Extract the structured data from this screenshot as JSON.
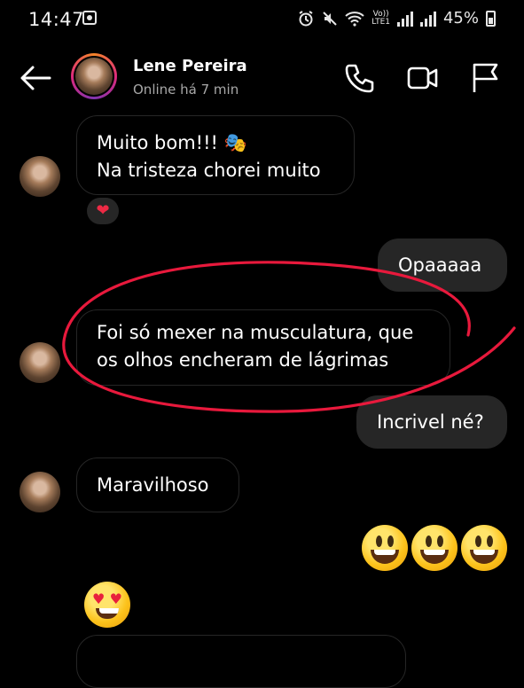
{
  "status_bar": {
    "time": "14:47",
    "network_label_top": "Vo))",
    "network_label_bottom": "LTE1",
    "battery": "45%"
  },
  "header": {
    "contact_name": "Lene Pereira",
    "presence": "Online há 7 min",
    "icons": [
      "back-arrow-icon",
      "phone-icon",
      "video-camera-icon",
      "flag-icon"
    ]
  },
  "messages": [
    {
      "from": "contact",
      "lines": [
        "Muito bom!!! 🎭",
        "Na tristeza chorei muito"
      ],
      "reaction": "❤"
    },
    {
      "from": "me",
      "text": "Opaaaaa"
    },
    {
      "from": "contact",
      "lines": [
        "Foi só mexer na musculatura, que",
        "os olhos encheram de lágrimas"
      ]
    },
    {
      "from": "me",
      "text": "Incrivel né?"
    },
    {
      "from": "contact",
      "text": "Maravilhoso"
    },
    {
      "from": "me",
      "emoji": [
        "grinning-face",
        "grinning-face",
        "grinning-face"
      ]
    },
    {
      "from": "contact",
      "emoji": [
        "heart-eyes-face"
      ]
    }
  ],
  "colors": {
    "background": "#000000",
    "outgoing_bubble": "#262626",
    "incoming_border": "#262626",
    "annotation_red": "#e8193c",
    "secondary_text": "#a8a8a8"
  }
}
